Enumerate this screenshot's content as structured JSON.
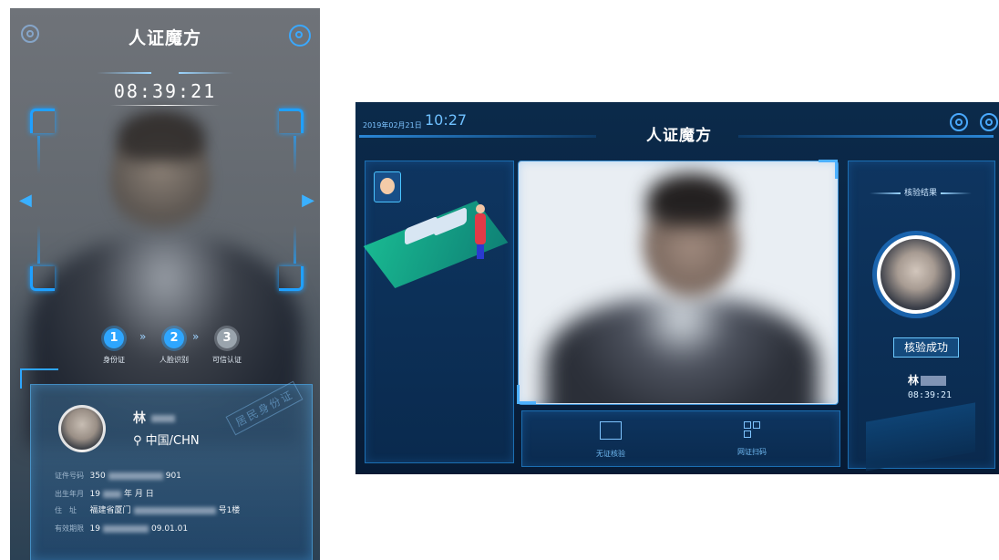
{
  "phone": {
    "title": "人证魔方",
    "clock": "08:39:21",
    "steps": [
      {
        "num": "1",
        "label": "身份证"
      },
      {
        "num": "2",
        "label": "人脸识别"
      },
      {
        "num": "3",
        "label": "可信认证"
      }
    ],
    "card": {
      "name": "林",
      "nationality": "中国/CHN",
      "stamp": "居民身份证",
      "rows": [
        {
          "key": "证件号码",
          "prefix": "350",
          "suffix": "901"
        },
        {
          "key": "出生年月",
          "prefix": "19",
          "suffix": "年 月 日"
        },
        {
          "key": "住　址",
          "prefix": "福建省厦门",
          "suffix": "号1楼"
        },
        {
          "key": "有效期限",
          "prefix": "19",
          "suffix": "09.01.01"
        }
      ]
    }
  },
  "tablet": {
    "date": "2019年02月21日",
    "time": "10:27",
    "title": "人证魔方",
    "options": [
      {
        "label": "无证核验",
        "icon": "id-card-icon"
      },
      {
        "label": "网证扫码",
        "icon": "qr-code-icon"
      }
    ],
    "result": {
      "heading": "核验结果",
      "status": "核验成功",
      "name": "林",
      "time": "08:39:21"
    }
  },
  "colors": {
    "accent": "#1fa0ff",
    "tablet_bg": "#0a2442",
    "step_active": "#2ea6ff",
    "step_inactive": "#9aa4ad"
  }
}
